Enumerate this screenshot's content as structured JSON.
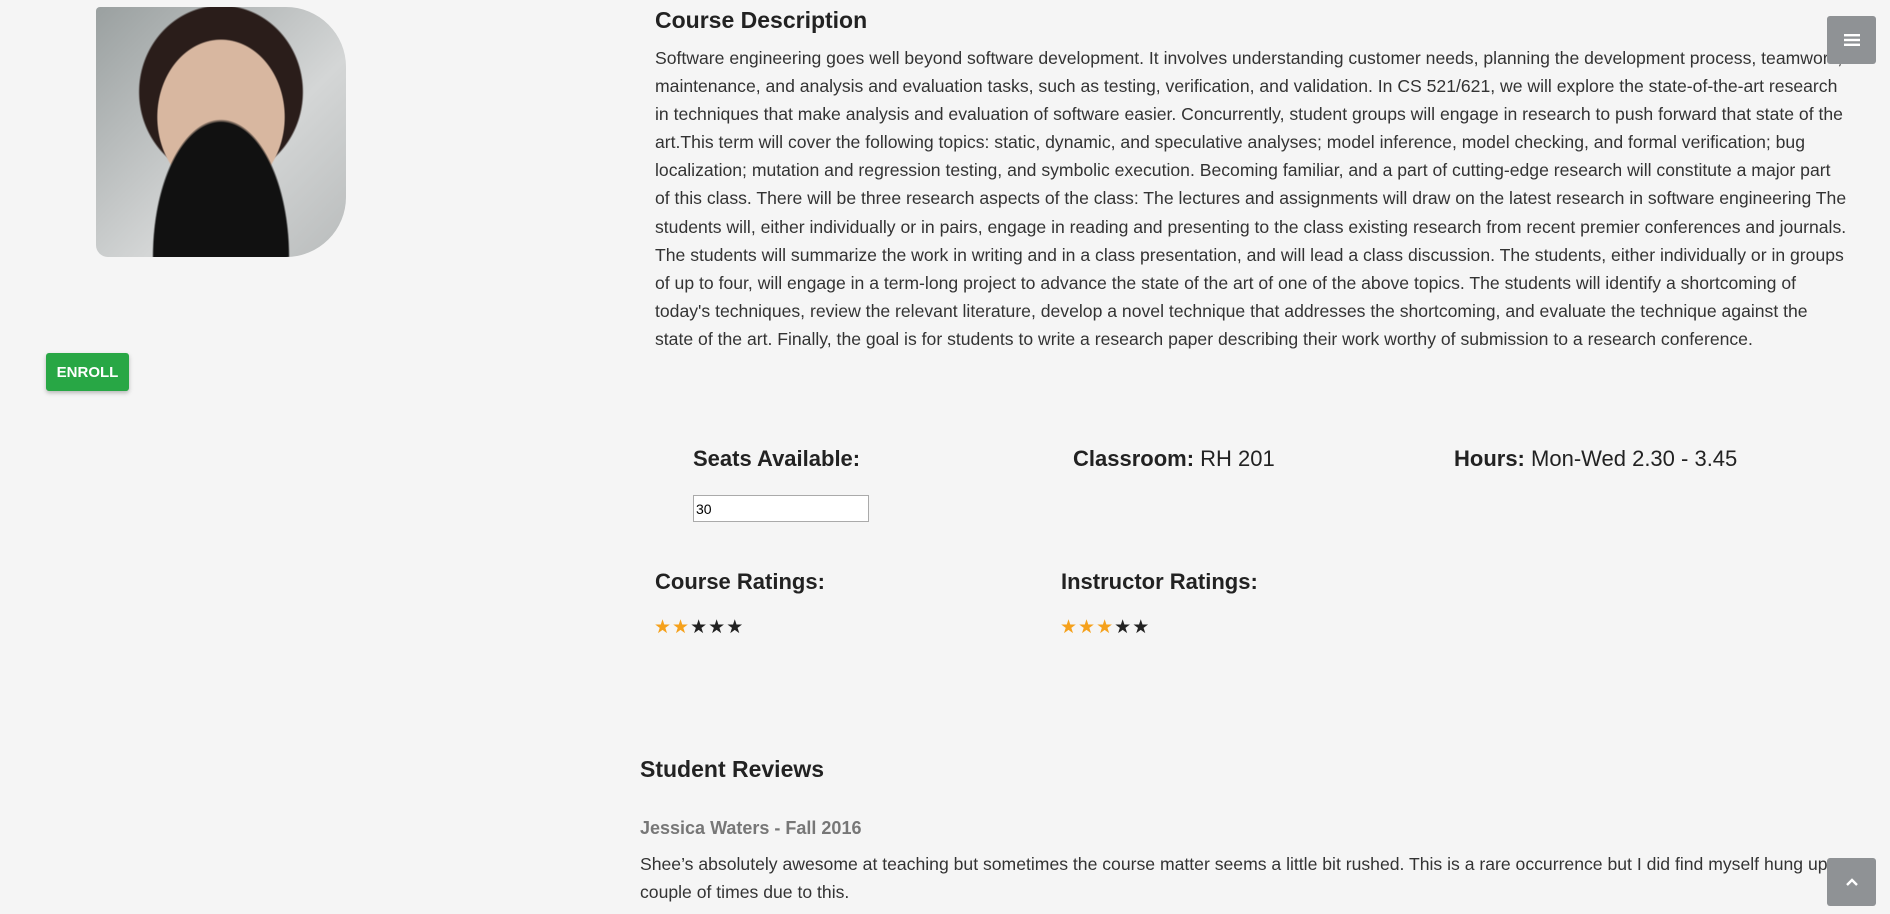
{
  "enroll_label": "ENROLL",
  "course_description": {
    "heading": "Course Description",
    "text": "Software engineering goes well beyond software development. It involves understanding customer needs, planning the development process, teamwork, maintenance, and analysis and evaluation tasks, such as testing, verification, and validation. In CS 521/621, we will explore the state-of-the-art research in techniques that make analysis and evaluation of software easier. Concurrently, student groups will engage in research to push forward that state of the art.This term will cover the following topics: static, dynamic, and speculative analyses; model inference, model checking, and formal verification; bug localization; mutation and regression testing, and symbolic execution. Becoming familiar, and a part of cutting-edge research will constitute a major part of this class. There will be three research aspects of the class: The lectures and assignments will draw on the latest research in software engineering The students will, either individually or in pairs, engage in reading and presenting to the class existing research from recent premier conferences and journals. The students will summarize the work in writing and in a class presentation, and will lead a class discussion. The students, either individually or in groups of up to four, will engage in a term-long project to advance the state of the art of one of the above topics. The students will identify a shortcoming of today's techniques, review the relevant literature, develop a novel technique that addresses the shortcoming, and evaluate the technique against the state of the art. Finally, the goal is for students to write a research paper describing their work worthy of submission to a research conference."
  },
  "details": {
    "seats_label": "Seats Available:",
    "seats_value": "30",
    "classroom_label": "Classroom:",
    "classroom_value": "RH 201",
    "hours_label": "Hours:",
    "hours_value": "Mon-Wed 2.30 - 3.45"
  },
  "ratings": {
    "course_label": "Course Ratings:",
    "course_stars": 2,
    "instructor_label": "Instructor Ratings:",
    "instructor_stars": 3,
    "max_stars": 5,
    "filled_color": "#f5a11c",
    "empty_color": "#222222"
  },
  "reviews": {
    "heading": "Student Reviews",
    "items": [
      {
        "author": "Jessica Waters - Fall 2016",
        "text": "Shee’s absolutely awesome at teaching but sometimes the course matter seems a little bit rushed. This is a rare occurrence but I did find myself hung up a couple of times due to this."
      }
    ]
  }
}
